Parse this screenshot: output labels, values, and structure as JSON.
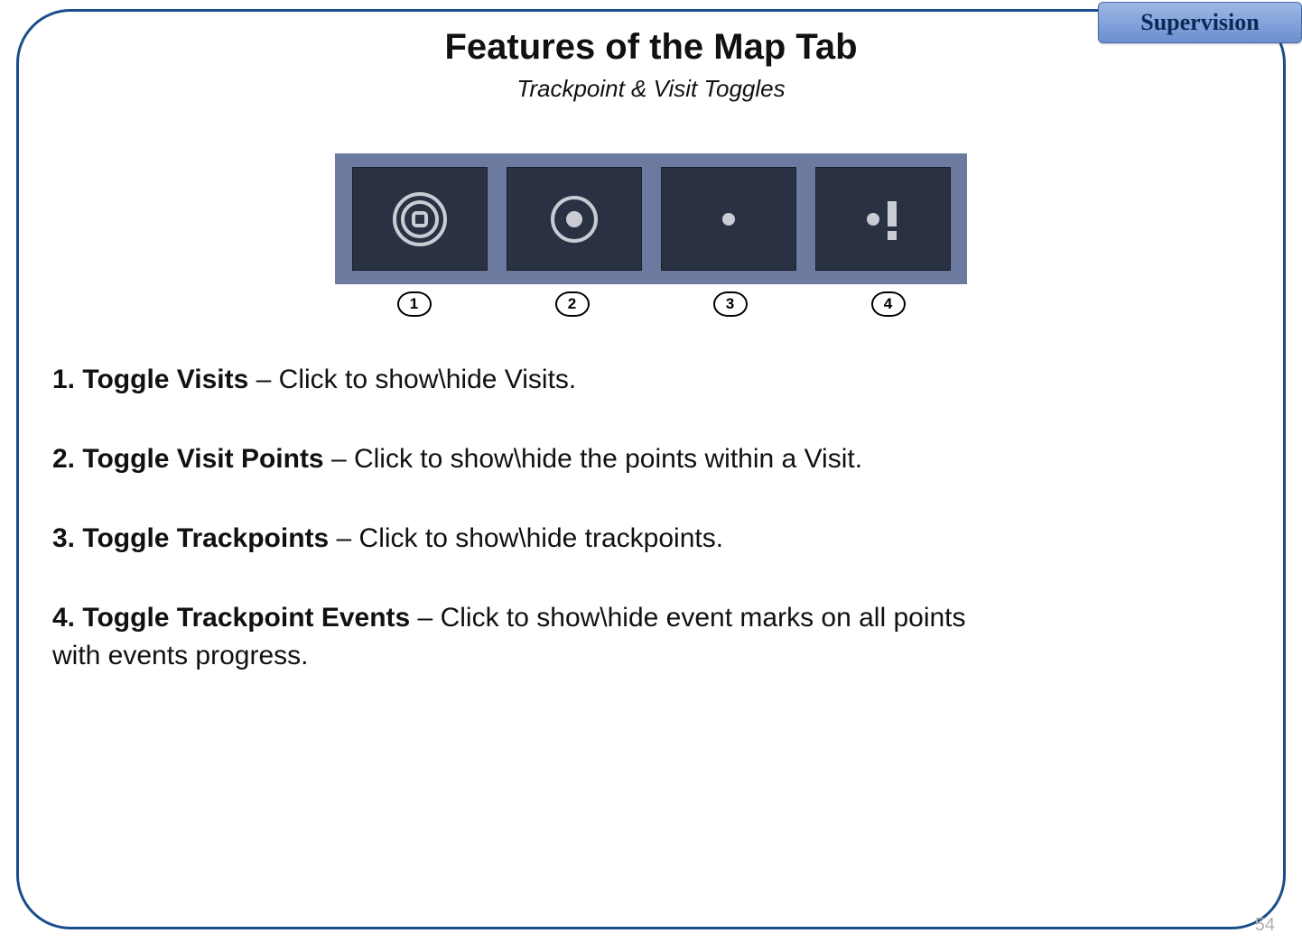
{
  "badge": "Supervision",
  "title": "Features of the Map Tab",
  "subtitle": "Trackpoint & Visit Toggles",
  "toolbar": {
    "labels": [
      "1",
      "2",
      "3",
      "4"
    ]
  },
  "items": [
    {
      "num": "1.",
      "name": "Toggle Visits",
      "desc": " – Click to show\\hide Visits."
    },
    {
      "num": "2.",
      "name": "Toggle Visit Points",
      "desc": " – Click to show\\hide the points within a Visit."
    },
    {
      "num": "3.",
      "name": "Toggle Trackpoints",
      "desc": " – Click to show\\hide trackpoints."
    },
    {
      "num": "4.",
      "name": "Toggle Trackpoint Events",
      "desc": " – Click to show\\hide event marks on all points with events progress."
    }
  ],
  "page_number": "54"
}
